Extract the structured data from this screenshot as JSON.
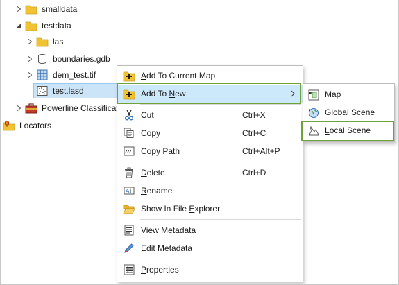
{
  "tree": {
    "items": [
      {
        "label": "smalldata",
        "icon": "folder-icon",
        "expander": "collapsed"
      },
      {
        "label": "testdata",
        "icon": "folder-icon",
        "expander": "expanded"
      },
      {
        "label": "las",
        "icon": "folder-icon",
        "expander": "collapsed"
      },
      {
        "label": "boundaries.gdb",
        "icon": "geodatabase-icon",
        "expander": "collapsed"
      },
      {
        "label": "dem_test.tif",
        "icon": "raster-icon",
        "expander": "collapsed"
      },
      {
        "label": "test.lasd",
        "icon": "las-dataset-icon",
        "expander": "none",
        "selected": true
      },
      {
        "label": "Powerline Classificati",
        "icon": "toolbox-icon",
        "expander": "collapsed"
      },
      {
        "label": "Locators",
        "icon": "locators-icon",
        "expander": "none"
      }
    ]
  },
  "context_menu": {
    "items": [
      {
        "label": "Add To Current Map",
        "underline": "",
        "shortcut": "",
        "icon": "add-to-map-icon"
      },
      {
        "label": "Add To New",
        "underline": "N",
        "shortcut": "",
        "icon": "add-to-new-icon",
        "has_submenu": true,
        "highlighted": true
      },
      {
        "label": "Cut",
        "underline": "t",
        "shortcut": "Ctrl+X",
        "icon": "scissors-icon"
      },
      {
        "label": "Copy",
        "underline": "C",
        "shortcut": "Ctrl+C",
        "icon": "copy-icon"
      },
      {
        "label": "Copy Path",
        "underline": "P",
        "shortcut": "Ctrl+Alt+P",
        "icon": "copy-path-icon"
      },
      {
        "label": "Delete",
        "underline": "D",
        "shortcut": "Ctrl+D",
        "icon": "trash-icon"
      },
      {
        "label": "Rename",
        "underline": "R",
        "shortcut": "",
        "icon": "rename-icon"
      },
      {
        "label": "Show In File Explorer",
        "underline": "",
        "shortcut": "",
        "icon": "open-folder-icon"
      },
      {
        "label": "View Metadata",
        "underline": "M",
        "shortcut": "",
        "icon": "view-metadata-icon"
      },
      {
        "label": "Edit Metadata",
        "underline": "E",
        "shortcut": "",
        "icon": "pencil-icon"
      },
      {
        "label": "Properties",
        "underline": "P",
        "shortcut": "",
        "icon": "properties-icon"
      }
    ]
  },
  "submenu": {
    "items": [
      {
        "label": "Map",
        "icon": "new-map-icon"
      },
      {
        "label": "Global Scene",
        "icon": "global-scene-icon"
      },
      {
        "label": "Local Scene",
        "icon": "local-scene-icon"
      }
    ]
  },
  "colors": {
    "highlight_border": "#6fa33a",
    "menu_hover": "#cce8fb",
    "selection": "#cce4f7",
    "folder": "#f1c232"
  }
}
